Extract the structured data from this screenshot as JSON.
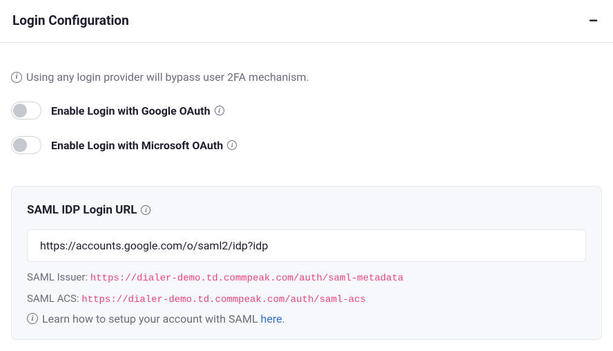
{
  "header": {
    "title": "Login Configuration",
    "collapse_icon": "−"
  },
  "notice": {
    "text": "Using any login provider will bypass user 2FA mechanism."
  },
  "toggles": {
    "google": {
      "label": "Enable Login with Google OAuth",
      "enabled": false
    },
    "microsoft": {
      "label": "Enable Login with Microsoft OAuth",
      "enabled": false
    }
  },
  "saml": {
    "title": "SAML IDP Login URL",
    "input_value": "https://accounts.google.com/o/saml2/idp?idp",
    "issuer_label": "SAML Issuer:",
    "issuer_value": "https://dialer-demo.td.commpeak.com/auth/saml-metadata",
    "acs_label": "SAML ACS:",
    "acs_value": "https://dialer-demo.td.commpeak.com/auth/saml-acs",
    "learn_text_pre": "Learn how to setup your account with SAML ",
    "learn_link": "here",
    "learn_text_post": "."
  }
}
